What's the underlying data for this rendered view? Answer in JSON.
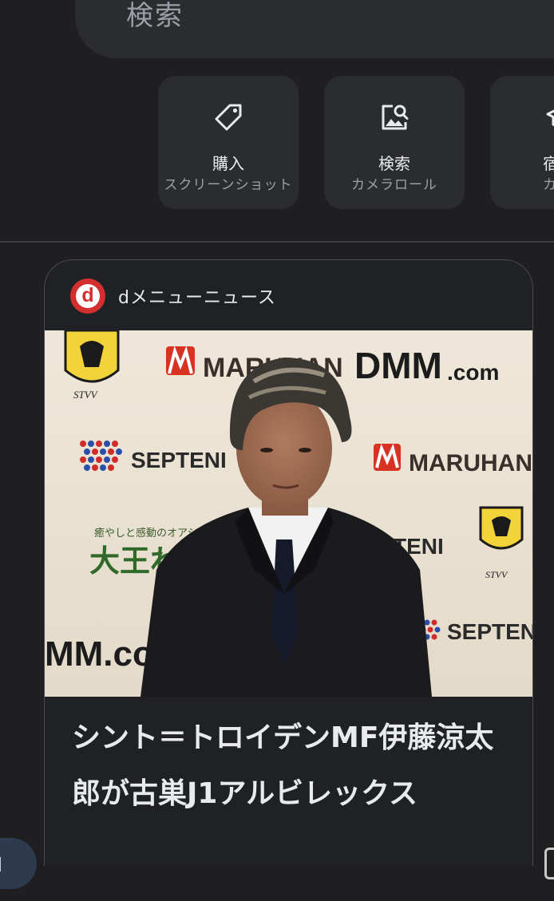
{
  "search": {
    "placeholder_text": "検索"
  },
  "chips": [
    {
      "icon": "tag-icon",
      "title": "購入",
      "subtitle": "スクリーンショット"
    },
    {
      "icon": "image-search-icon",
      "title": "検索",
      "subtitle": "カメラロール"
    },
    {
      "icon": "school-icon",
      "title": "宿",
      "subtitle": "カ"
    }
  ],
  "news_card": {
    "source_logo_letter": "d",
    "source": "dメニューニュース",
    "image_alt_icon": "news-photo",
    "headline": "シント＝トロイデンMF伊藤涼太郎が古巣J1アルビレックス",
    "photo_texts": {
      "maruhan": "MARUHAN",
      "dmm": "DMM",
      "dmm_com": ".com",
      "septeni": "SEPTENI",
      "stvv": "STVV",
      "onsen_small": "癒やしと感動のオアシ",
      "onsen_big": "大王わさ",
      "dmm_bottom": "MM.co"
    }
  },
  "colors": {
    "background": "#1f1f21",
    "surface": "#2b2c2f",
    "accent_red": "#d32f2f",
    "text_primary": "#e8eaed",
    "text_secondary": "#9aa0a6"
  }
}
